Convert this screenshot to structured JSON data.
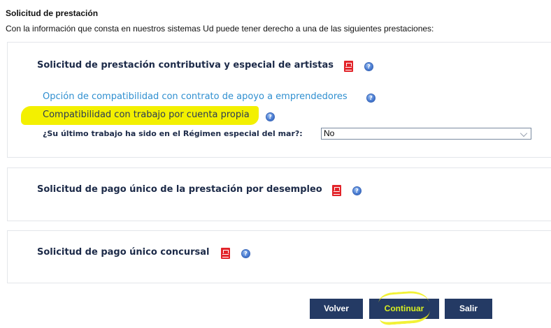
{
  "header": {
    "title": "Solicitud de prestación",
    "subtitle": "Con la información que consta en nuestros sistemas Ud puede tener derecho a una de las siguientes prestaciones:"
  },
  "sections": [
    {
      "title": "Solicitud de prestación contributiva y especial de artistas",
      "options": [
        {
          "label": "Opción de compatibilidad con contrato de apoyo a emprendedores"
        },
        {
          "label": "Compatibilidad con trabajo por cuenta propia",
          "highlighted": true
        }
      ],
      "question": {
        "label": "¿Su último trabajo ha sido en el Régimen especial del mar?:",
        "selected": "No"
      }
    },
    {
      "title": "Solicitud de pago único de la prestación por desempleo"
    },
    {
      "title": "Solicitud de pago único concursal"
    }
  ],
  "buttons": {
    "volver": "Volver",
    "continuar": "Continuar",
    "salir": "Salir"
  },
  "colors": {
    "panel_title": "#1c2a48",
    "link": "#2f8fd0",
    "button_bg": "#243a64",
    "highlight": "#f3f000",
    "pdf_red": "#e2242a"
  },
  "icons": [
    "pdf-icon",
    "help-icon",
    "chevron-down-icon"
  ]
}
